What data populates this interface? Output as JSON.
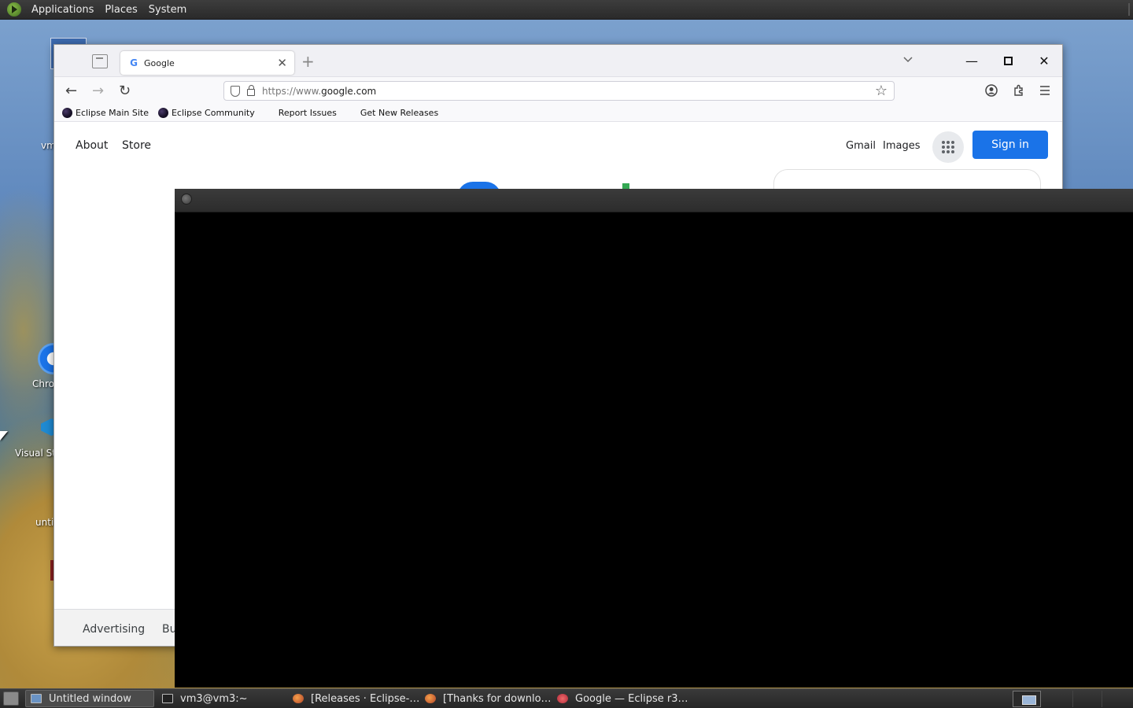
{
  "top_panel": {
    "menus": [
      "Applications",
      "Places",
      "System"
    ]
  },
  "desktop_icons": [
    {
      "label": "vm"
    },
    {
      "label": "Chro"
    },
    {
      "label": "Visual St"
    },
    {
      "label": "unti"
    }
  ],
  "browser": {
    "tab": {
      "title": "Google",
      "favicon": "G"
    },
    "url": {
      "proto": "https://www.",
      "host": "google.com"
    },
    "bookmarks": [
      "Eclipse Main Site",
      "Eclipse Community",
      "Report Issues",
      "Get New Releases"
    ],
    "page": {
      "left_links": [
        "About",
        "Store"
      ],
      "right_links": [
        "Gmail",
        "Images"
      ],
      "sign_in": "Sign in",
      "footer": [
        "Advertising",
        "Bu"
      ]
    }
  },
  "taskbar": {
    "tasks": [
      {
        "label": "Untitled window",
        "icon": "window-icon",
        "active": true
      },
      {
        "label": "vm3@vm3:~",
        "icon": "terminal-icon"
      },
      {
        "label": "[Releases · Eclipse-…",
        "icon": "firefox-icon"
      },
      {
        "label": "[Thanks for downlo…",
        "icon": "firefox-icon"
      },
      {
        "label": "Google — Eclipse r3…",
        "icon": "eclipse-icon"
      }
    ]
  },
  "colors": {
    "accent_blue": "#1a73e8",
    "panel_bg": "#2f2f2f",
    "overlay_window": "#000000"
  }
}
